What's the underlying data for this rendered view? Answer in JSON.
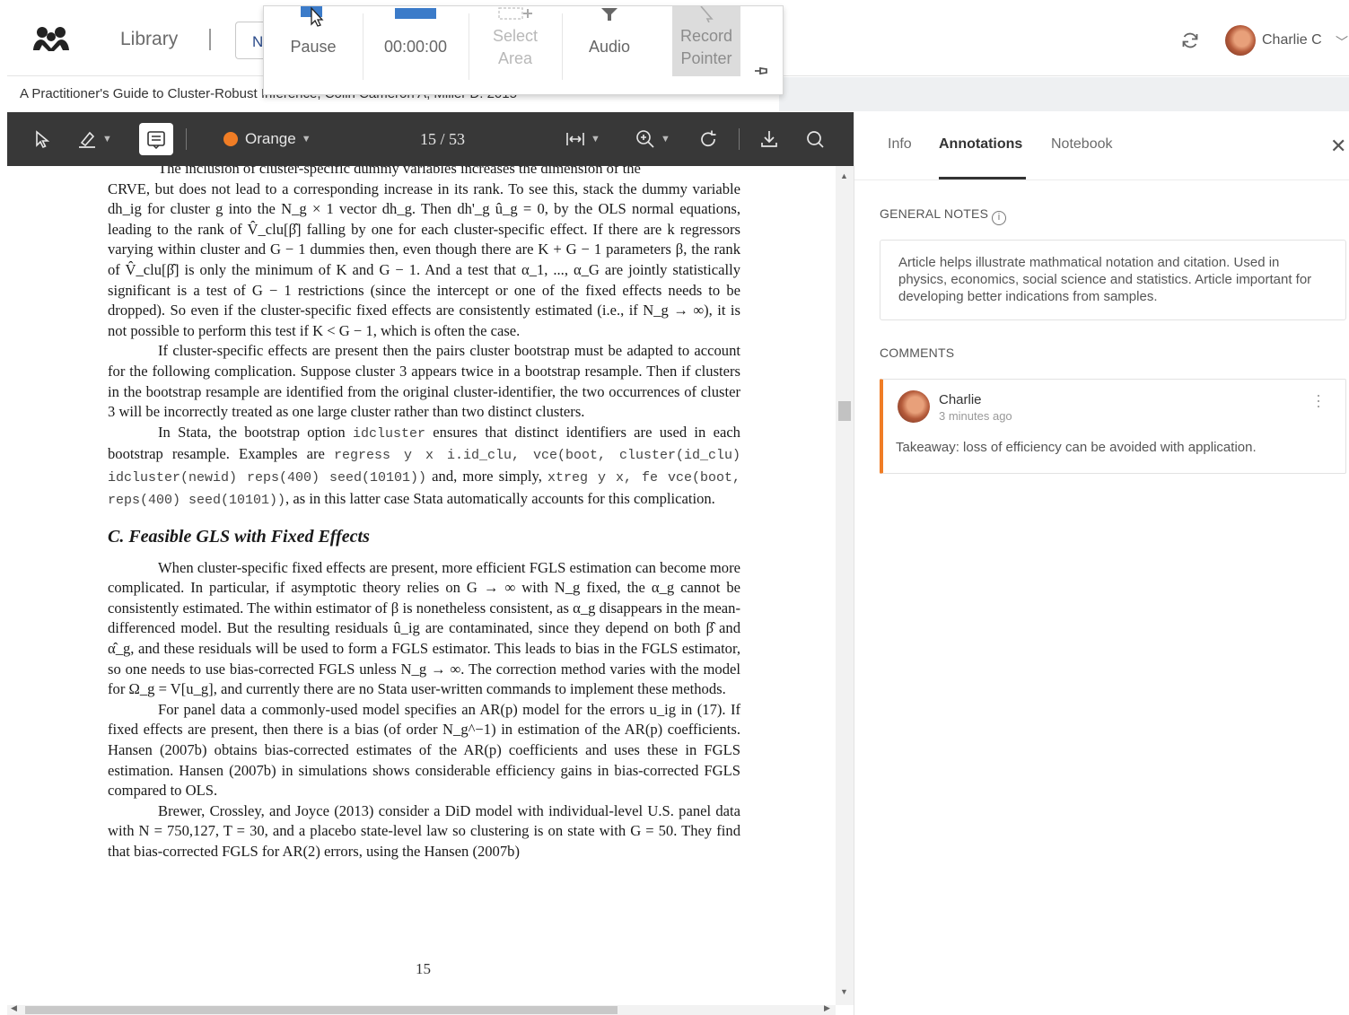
{
  "app": {
    "library_label": "Library",
    "tab_stub": "N",
    "user_name": "Charlie C",
    "doc_title": "A Practitioner's Guide to Cluster-Robust Inference, Colin Cameron A, Miller D. 2015"
  },
  "recorder": {
    "pause_label": "Pause",
    "timer": "00:00:00",
    "select_area_line1": "Select",
    "select_area_line2": "Area",
    "audio_label": "Audio",
    "record_pointer_line1": "Record",
    "record_pointer_line2": "Pointer"
  },
  "toolbar": {
    "color_label": "Orange",
    "page_indicator": "15 / 53",
    "accent_color": "#f07d25"
  },
  "document": {
    "p1_l1": "The inclusion of cluster-specific dummy variables increases the dimension of the",
    "p1": "CRVE, but does not lead to a corresponding increase in its rank. To see this, stack the dummy variable dh_ig for cluster g into the N_g × 1 vector dh_g. Then dh'_g û_g = 0, by the OLS normal equations, leading to the rank of V̂_clu[β̂] falling by one for each cluster-specific effect. If there are k regressors varying within cluster and G − 1 dummies then, even though there are K + G − 1 parameters β, the rank of V̂_clu[β̂] is only the minimum of K and G − 1. And a test that α_1, ..., α_G are jointly statistically significant is a test of G − 1 restrictions (since the intercept or one of the fixed effects needs to be dropped). So even if the cluster-specific fixed effects are consistently estimated (i.e., if N_g → ∞), it is not possible to perform this test if K < G − 1, which is often the case.",
    "p2": "If cluster-specific effects are present then the pairs cluster bootstrap must be adapted to account for the following complication. Suppose cluster 3 appears twice in a bootstrap resample. Then if clusters in the bootstrap resample are identified from the original cluster-identifier, the two occurrences of cluster 3 will be incorrectly treated as one large cluster rather than two distinct clusters.",
    "p3_a": "In Stata, the bootstrap option",
    "p3_code1": "idcluster",
    "p3_b": "ensures that distinct identifiers are used in each bootstrap resample. Examples are",
    "p3_code2": "regress y x i.id_clu, vce(boot, cluster(id_clu) idcluster(newid) reps(400) seed(10101))",
    "p3_c": "and, more simply,",
    "p3_code3": "xtreg y x, fe vce(boot, reps(400) seed(10101))",
    "p3_d": ", as in this latter case Stata automatically accounts for this complication.",
    "section_heading": "C. Feasible GLS with Fixed Effects",
    "p4": "When cluster-specific fixed effects are present, more efficient FGLS estimation can become more complicated. In particular, if asymptotic theory relies on G → ∞ with N_g fixed, the α_g cannot be consistently estimated. The within estimator of β is nonetheless consistent, as α_g disappears in the mean-differenced model. But the resulting residuals û_ig are contaminated, since they depend on both β̂ and α̂_g, and these residuals will be used to form a FGLS estimator. This leads to bias in the FGLS estimator, so one needs to use bias-corrected FGLS unless N_g → ∞. The correction method varies with the model for Ω_g = V[u_g], and currently there are no Stata user-written commands to implement these methods.",
    "p5": "For panel data a commonly-used model specifies an AR(p) model for the errors u_ig in (17). If fixed effects are present, then there is a bias (of order N_g^−1) in estimation of the AR(p) coefficients. Hansen (2007b) obtains bias-corrected estimates of the AR(p) coefficients and uses these in FGLS estimation. Hansen (2007b) in simulations shows considerable efficiency gains in bias-corrected FGLS compared to OLS.",
    "p6": "Brewer, Crossley, and Joyce (2013) consider a DiD model with individual-level U.S. panel data with N = 750,127, T = 30, and a placebo state-level law so clustering is on state with G = 50. They find that bias-corrected FGLS for AR(2) errors, using the Hansen (2007b)",
    "page_number": "15"
  },
  "sidebar": {
    "tabs": [
      "Info",
      "Annotations",
      "Notebook"
    ],
    "general_notes_label": "GENERAL NOTES",
    "general_notes_text": "Article helps illustrate mathmatical notation and citation. Used in physics, economics, social science and statistics. Article important for developing better indications from samples.",
    "comments_label": "COMMENTS",
    "comment": {
      "author": "Charlie",
      "time": "3 minutes ago",
      "body": "Takeaway: loss of efficiency can be avoided with application."
    }
  }
}
